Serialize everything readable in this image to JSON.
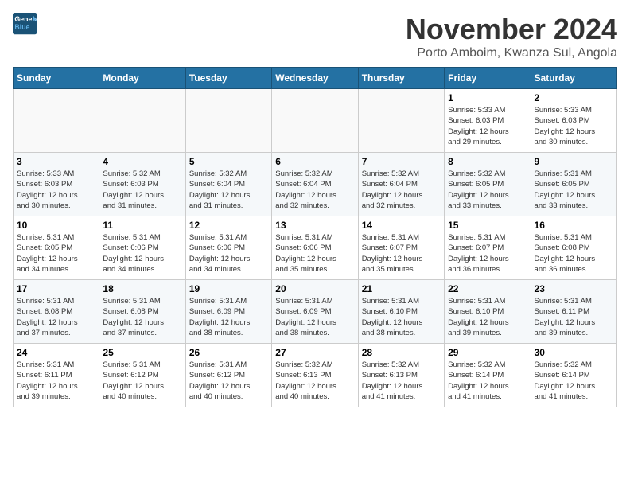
{
  "header": {
    "logo_line1": "General",
    "logo_line2": "Blue",
    "month_title": "November 2024",
    "subtitle": "Porto Amboim, Kwanza Sul, Angola"
  },
  "weekdays": [
    "Sunday",
    "Monday",
    "Tuesday",
    "Wednesday",
    "Thursday",
    "Friday",
    "Saturday"
  ],
  "weeks": [
    [
      {
        "day": "",
        "detail": ""
      },
      {
        "day": "",
        "detail": ""
      },
      {
        "day": "",
        "detail": ""
      },
      {
        "day": "",
        "detail": ""
      },
      {
        "day": "",
        "detail": ""
      },
      {
        "day": "1",
        "detail": "Sunrise: 5:33 AM\nSunset: 6:03 PM\nDaylight: 12 hours\nand 29 minutes."
      },
      {
        "day": "2",
        "detail": "Sunrise: 5:33 AM\nSunset: 6:03 PM\nDaylight: 12 hours\nand 30 minutes."
      }
    ],
    [
      {
        "day": "3",
        "detail": "Sunrise: 5:33 AM\nSunset: 6:03 PM\nDaylight: 12 hours\nand 30 minutes."
      },
      {
        "day": "4",
        "detail": "Sunrise: 5:32 AM\nSunset: 6:03 PM\nDaylight: 12 hours\nand 31 minutes."
      },
      {
        "day": "5",
        "detail": "Sunrise: 5:32 AM\nSunset: 6:04 PM\nDaylight: 12 hours\nand 31 minutes."
      },
      {
        "day": "6",
        "detail": "Sunrise: 5:32 AM\nSunset: 6:04 PM\nDaylight: 12 hours\nand 32 minutes."
      },
      {
        "day": "7",
        "detail": "Sunrise: 5:32 AM\nSunset: 6:04 PM\nDaylight: 12 hours\nand 32 minutes."
      },
      {
        "day": "8",
        "detail": "Sunrise: 5:32 AM\nSunset: 6:05 PM\nDaylight: 12 hours\nand 33 minutes."
      },
      {
        "day": "9",
        "detail": "Sunrise: 5:31 AM\nSunset: 6:05 PM\nDaylight: 12 hours\nand 33 minutes."
      }
    ],
    [
      {
        "day": "10",
        "detail": "Sunrise: 5:31 AM\nSunset: 6:05 PM\nDaylight: 12 hours\nand 34 minutes."
      },
      {
        "day": "11",
        "detail": "Sunrise: 5:31 AM\nSunset: 6:06 PM\nDaylight: 12 hours\nand 34 minutes."
      },
      {
        "day": "12",
        "detail": "Sunrise: 5:31 AM\nSunset: 6:06 PM\nDaylight: 12 hours\nand 34 minutes."
      },
      {
        "day": "13",
        "detail": "Sunrise: 5:31 AM\nSunset: 6:06 PM\nDaylight: 12 hours\nand 35 minutes."
      },
      {
        "day": "14",
        "detail": "Sunrise: 5:31 AM\nSunset: 6:07 PM\nDaylight: 12 hours\nand 35 minutes."
      },
      {
        "day": "15",
        "detail": "Sunrise: 5:31 AM\nSunset: 6:07 PM\nDaylight: 12 hours\nand 36 minutes."
      },
      {
        "day": "16",
        "detail": "Sunrise: 5:31 AM\nSunset: 6:08 PM\nDaylight: 12 hours\nand 36 minutes."
      }
    ],
    [
      {
        "day": "17",
        "detail": "Sunrise: 5:31 AM\nSunset: 6:08 PM\nDaylight: 12 hours\nand 37 minutes."
      },
      {
        "day": "18",
        "detail": "Sunrise: 5:31 AM\nSunset: 6:08 PM\nDaylight: 12 hours\nand 37 minutes."
      },
      {
        "day": "19",
        "detail": "Sunrise: 5:31 AM\nSunset: 6:09 PM\nDaylight: 12 hours\nand 38 minutes."
      },
      {
        "day": "20",
        "detail": "Sunrise: 5:31 AM\nSunset: 6:09 PM\nDaylight: 12 hours\nand 38 minutes."
      },
      {
        "day": "21",
        "detail": "Sunrise: 5:31 AM\nSunset: 6:10 PM\nDaylight: 12 hours\nand 38 minutes."
      },
      {
        "day": "22",
        "detail": "Sunrise: 5:31 AM\nSunset: 6:10 PM\nDaylight: 12 hours\nand 39 minutes."
      },
      {
        "day": "23",
        "detail": "Sunrise: 5:31 AM\nSunset: 6:11 PM\nDaylight: 12 hours\nand 39 minutes."
      }
    ],
    [
      {
        "day": "24",
        "detail": "Sunrise: 5:31 AM\nSunset: 6:11 PM\nDaylight: 12 hours\nand 39 minutes."
      },
      {
        "day": "25",
        "detail": "Sunrise: 5:31 AM\nSunset: 6:12 PM\nDaylight: 12 hours\nand 40 minutes."
      },
      {
        "day": "26",
        "detail": "Sunrise: 5:31 AM\nSunset: 6:12 PM\nDaylight: 12 hours\nand 40 minutes."
      },
      {
        "day": "27",
        "detail": "Sunrise: 5:32 AM\nSunset: 6:13 PM\nDaylight: 12 hours\nand 40 minutes."
      },
      {
        "day": "28",
        "detail": "Sunrise: 5:32 AM\nSunset: 6:13 PM\nDaylight: 12 hours\nand 41 minutes."
      },
      {
        "day": "29",
        "detail": "Sunrise: 5:32 AM\nSunset: 6:14 PM\nDaylight: 12 hours\nand 41 minutes."
      },
      {
        "day": "30",
        "detail": "Sunrise: 5:32 AM\nSunset: 6:14 PM\nDaylight: 12 hours\nand 41 minutes."
      }
    ]
  ]
}
